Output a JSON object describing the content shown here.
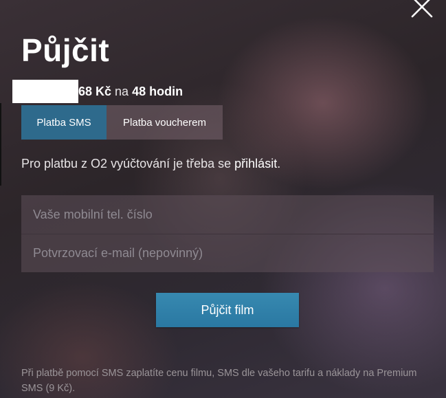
{
  "modal": {
    "title": "Půjčit",
    "close_icon": "close-icon",
    "price": {
      "amount": "68 Kč",
      "separator": "na",
      "duration": "48 hodin"
    },
    "tabs": [
      {
        "label": "Platba SMS",
        "active": true
      },
      {
        "label": "Platba voucherem",
        "active": false
      }
    ],
    "info": {
      "text": "Pro platbu z O2 vyúčtování je třeba se ",
      "link": "přihlásit",
      "suffix": "."
    },
    "form": {
      "phone_placeholder": "Vaše mobilní tel. číslo",
      "email_placeholder": "Potvrzovací e-mail (nepovinný)",
      "phone_value": "",
      "email_value": ""
    },
    "submit_label": "Půjčit film",
    "footnote": "Při platbě pomocí SMS zaplatíte cenu filmu, SMS dle vašeho tarifu a náklady na Premium SMS (9 Kč)."
  },
  "colors": {
    "accent": "#2e6a8c",
    "button": "#3082ab",
    "text": "#ffffff"
  }
}
